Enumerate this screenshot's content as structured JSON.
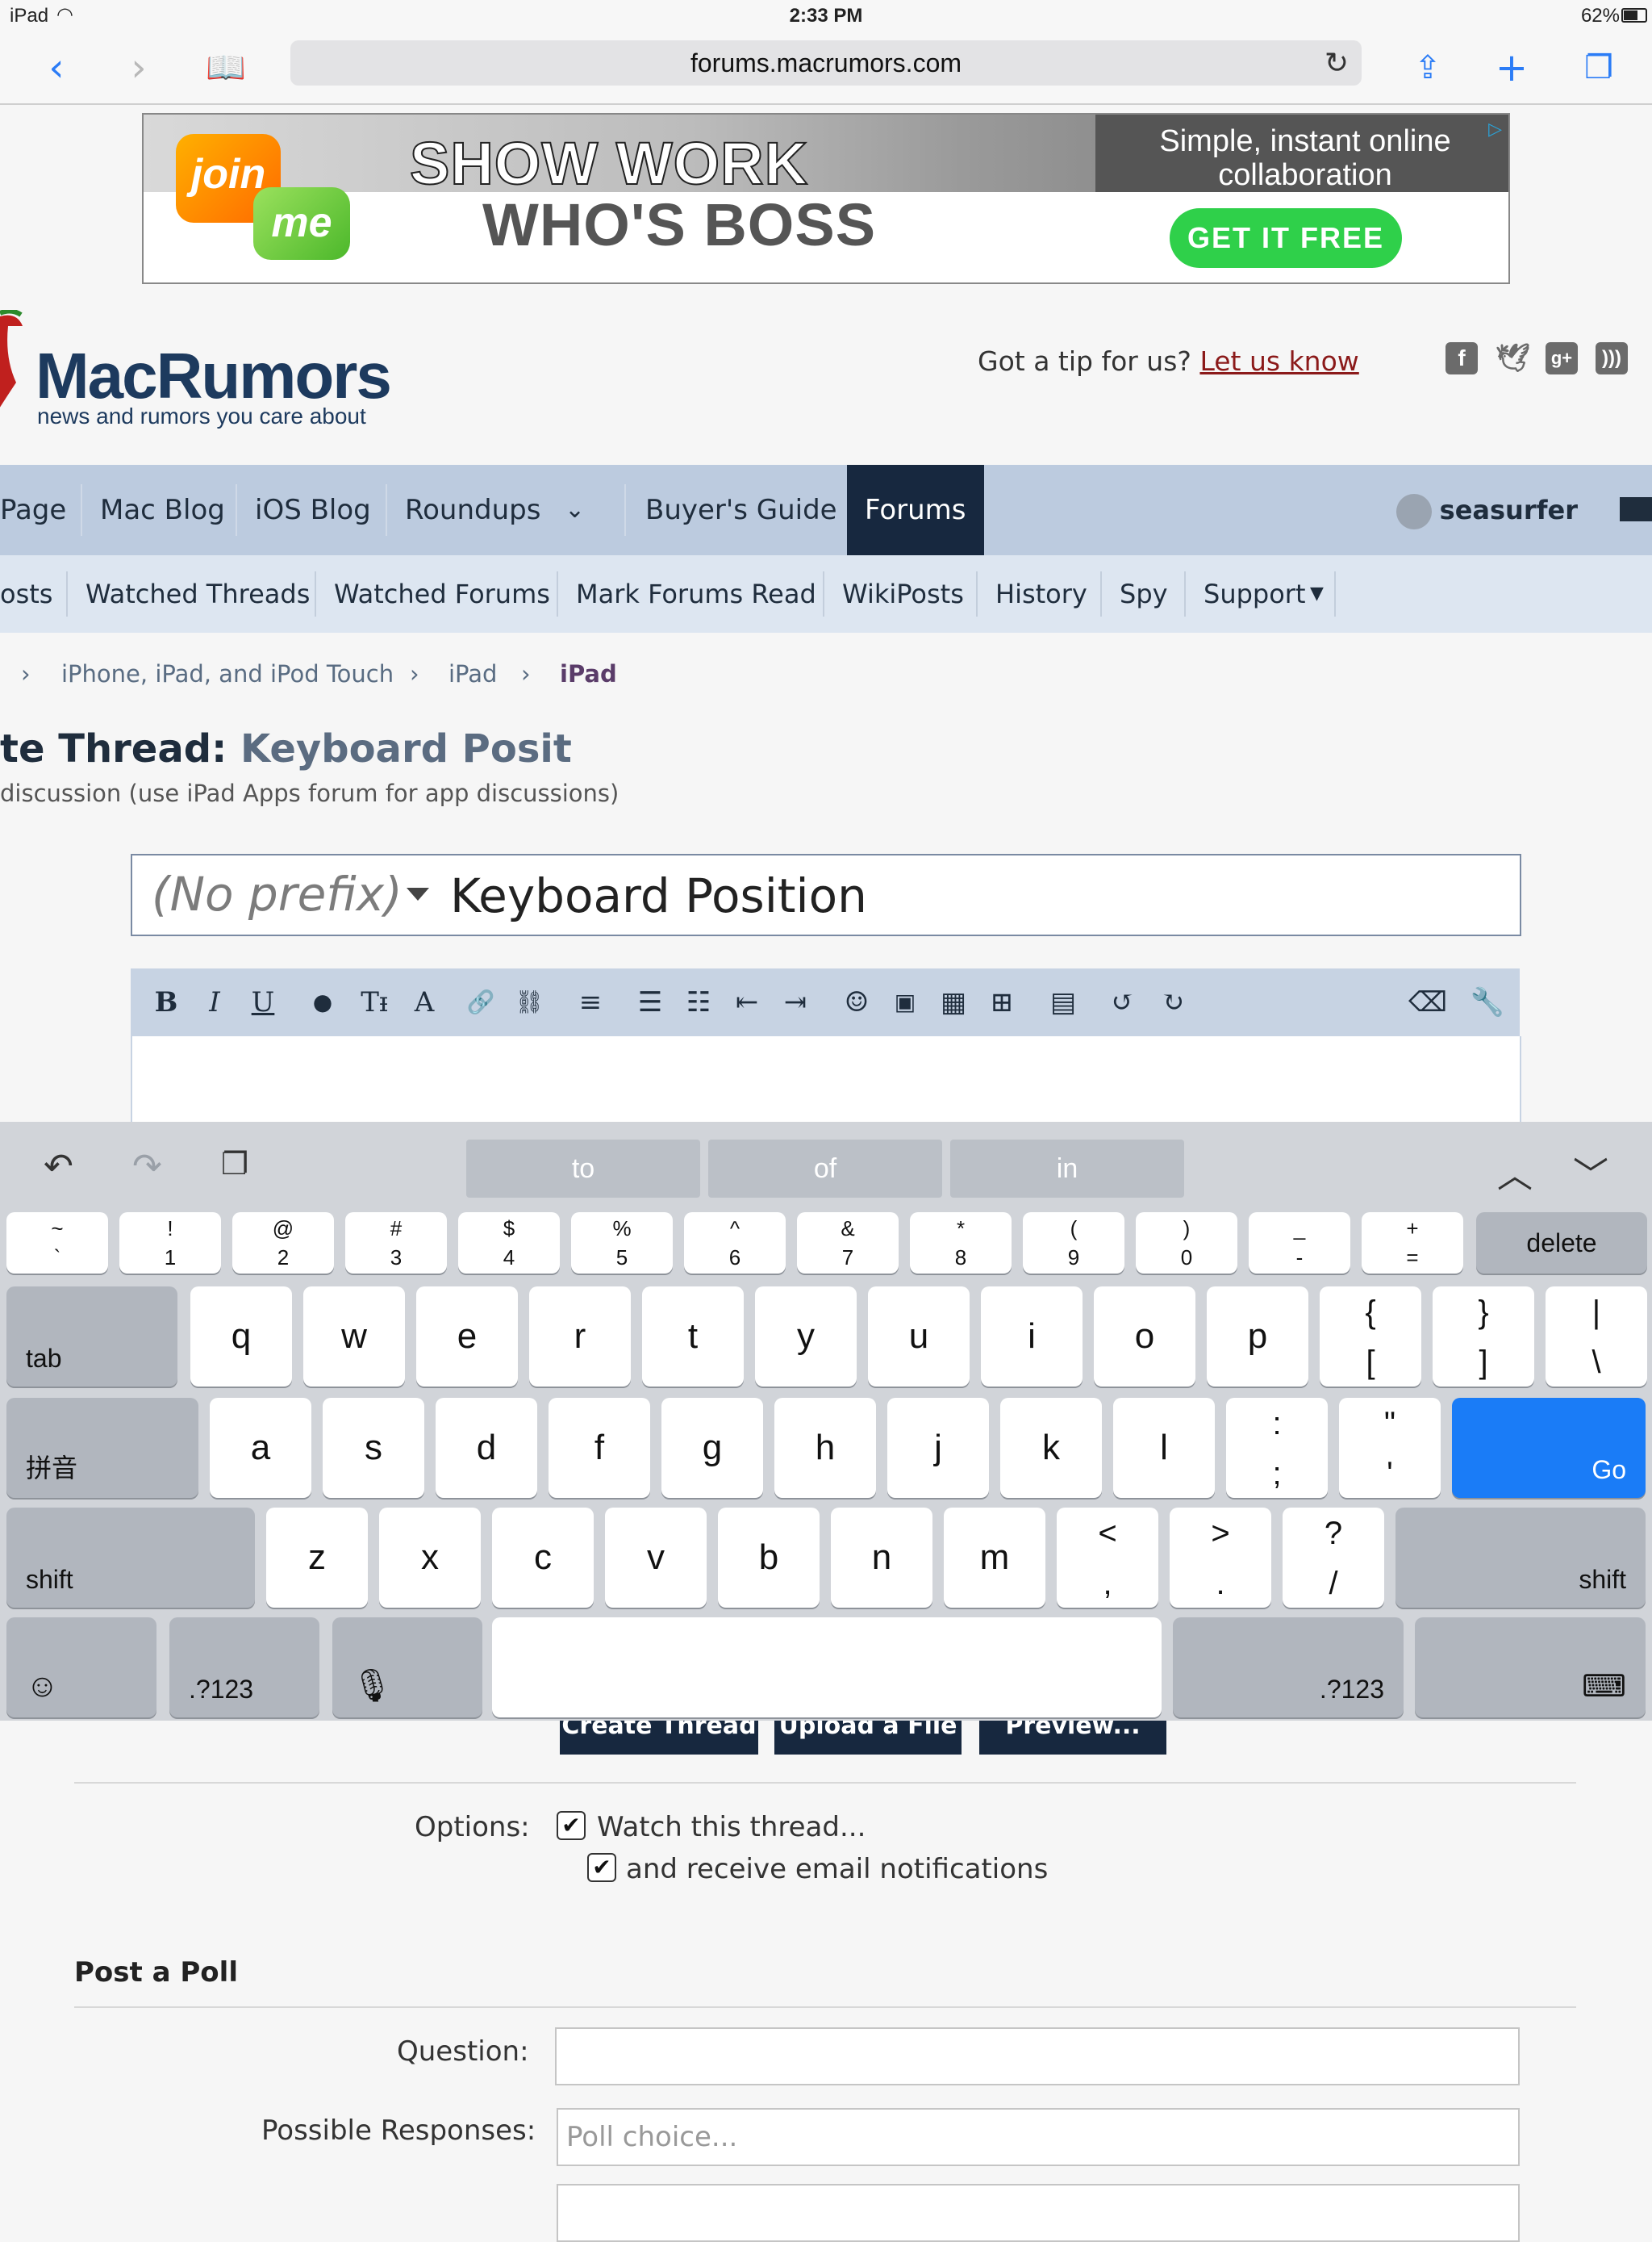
{
  "status_bar": {
    "device": "iPad",
    "time": "2:33 PM",
    "battery": "62%"
  },
  "browser": {
    "url": "forums.macrumors.com"
  },
  "ad": {
    "logo_top": "join",
    "logo_bottom": "me",
    "headline_1": "SHOW WORK",
    "headline_2": "WHO'S BOSS",
    "tagline": "Simple, instant online collaboration",
    "cta": "GET IT FREE"
  },
  "header": {
    "logo_name": "MacRumors",
    "logo_tagline": "news and rumors you care about",
    "tip_text": "Got a tip for us?",
    "tip_link": "Let us know",
    "social": [
      "facebook-icon",
      "twitter-icon",
      "google-plus-icon",
      "rss-icon"
    ]
  },
  "nav": {
    "items": [
      "Page",
      "Mac Blog",
      "iOS Blog",
      "Roundups",
      "Buyer's Guide",
      "Forums"
    ],
    "user": "seasurfer"
  },
  "subnav": {
    "items": [
      "osts",
      "Watched Threads",
      "Watched Forums",
      "Mark Forums Read",
      "WikiPosts",
      "History",
      "Spy",
      "Support"
    ]
  },
  "breadcrumbs": [
    "iPhone, iPad, and iPod Touch",
    "iPad",
    "iPad"
  ],
  "page": {
    "title_prefix": "te Thread:",
    "title_name": "Keyboard Posit",
    "subtitle": "discussion (use iPad Apps forum for app discussions)"
  },
  "thread_form": {
    "prefix": "(No prefix)",
    "title_value": "Keyboard Position"
  },
  "keyboard": {
    "suggestions": [
      "to",
      "of",
      "in"
    ],
    "number_row": [
      {
        "s": "~",
        "m": "`"
      },
      {
        "s": "!",
        "m": "1"
      },
      {
        "s": "@",
        "m": "2"
      },
      {
        "s": "#",
        "m": "3"
      },
      {
        "s": "$",
        "m": "4"
      },
      {
        "s": "%",
        "m": "5"
      },
      {
        "s": "^",
        "m": "6"
      },
      {
        "s": "&",
        "m": "7"
      },
      {
        "s": "*",
        "m": "8"
      },
      {
        "s": "(",
        "m": "9"
      },
      {
        "s": ")",
        "m": "0"
      },
      {
        "s": "_",
        "m": "-"
      },
      {
        "s": "+",
        "m": "="
      }
    ],
    "delete": "delete",
    "tab": "tab",
    "row1": [
      "q",
      "w",
      "e",
      "r",
      "t",
      "y",
      "u",
      "i",
      "o",
      "p"
    ],
    "row1_sym": [
      {
        "s": "{",
        "m": "["
      },
      {
        "s": "}",
        "m": "]"
      },
      {
        "s": "|",
        "m": "\\"
      }
    ],
    "lang": "拼音",
    "row2": [
      "a",
      "s",
      "d",
      "f",
      "g",
      "h",
      "j",
      "k",
      "l"
    ],
    "row2_sym": [
      {
        "s": ":",
        "m": ";"
      },
      {
        "s": "\"",
        "m": "'"
      }
    ],
    "go": "Go",
    "shift": "shift",
    "row3": [
      "z",
      "x",
      "c",
      "v",
      "b",
      "n",
      "m"
    ],
    "row3_sym": [
      {
        "s": "<",
        "m": ","
      },
      {
        "s": ">",
        "m": "."
      },
      {
        "s": "?",
        "m": "/"
      }
    ],
    "num_toggle": ".?123"
  },
  "form_buttons": [
    "Create Thread",
    "Upload a File",
    "Preview..."
  ],
  "options": {
    "label": "Options:",
    "watch": "Watch this thread...",
    "email": "and receive email notifications"
  },
  "poll": {
    "heading": "Post a Poll",
    "question_label": "Question:",
    "responses_label": "Possible Responses:",
    "choice_placeholder": "Poll choice..."
  }
}
